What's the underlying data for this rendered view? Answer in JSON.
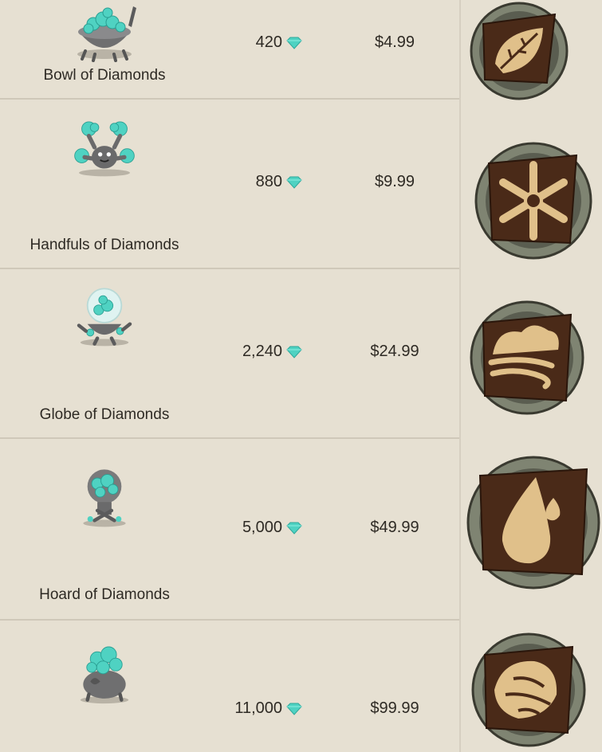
{
  "store": {
    "items": [
      {
        "name": "Bowl of Diamonds",
        "diamonds": "420",
        "price": "$4.99",
        "image_icon": "bowl-of-diamonds-icon",
        "badge_icon": "leaf-plant-icon"
      },
      {
        "name": "Handfuls of Diamonds",
        "diamonds": "880",
        "price": "$9.99",
        "image_icon": "handfuls-of-diamonds-icon",
        "badge_icon": "snowflake-cold-icon"
      },
      {
        "name": "Globe of Diamonds",
        "diamonds": "2,240",
        "price": "$24.99",
        "image_icon": "globe-of-diamonds-icon",
        "badge_icon": "wind-air-icon"
      },
      {
        "name": "Hoard of Diamonds",
        "diamonds": "5,000",
        "price": "$49.99",
        "image_icon": "hoard-of-diamonds-icon",
        "badge_icon": "water-drop-icon"
      },
      {
        "name": "",
        "diamonds": "11,000",
        "price": "$99.99",
        "image_icon": "diamond-monster-icon",
        "badge_icon": "earth-rock-icon"
      }
    ]
  },
  "colors": {
    "background": "#e6e0d2",
    "diamond": "#4fd2c2",
    "badge_parchment": "#e0c08a",
    "badge_leather": "#4a2a18",
    "badge_stone": "#7f8472"
  }
}
